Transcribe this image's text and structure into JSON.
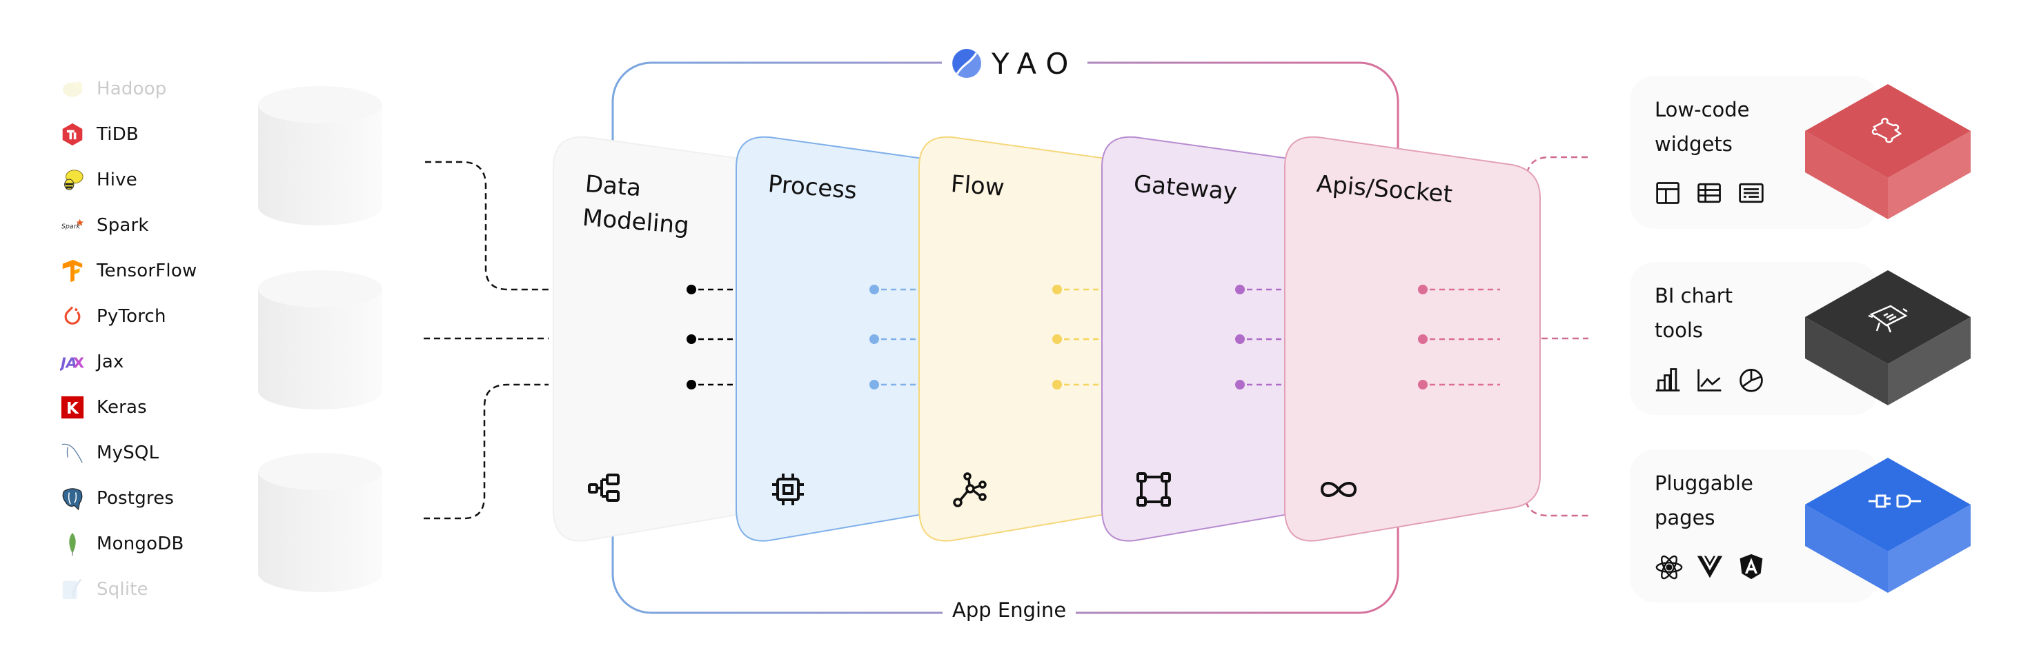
{
  "brand": {
    "name": "YAO",
    "logo_icon": "yao-yin-yang-logo"
  },
  "frame": {
    "bottom_label": "App Engine",
    "gradient_start": "#7aa7e0",
    "gradient_end": "#d9709a"
  },
  "sources": [
    {
      "label": "Hadoop",
      "icon": "hadoop-elephant-icon",
      "faded": true
    },
    {
      "label": "TiDB",
      "icon": "tidb-hexagon-icon",
      "faded": false
    },
    {
      "label": "Hive",
      "icon": "hive-bee-icon",
      "faded": false
    },
    {
      "label": "Spark",
      "icon": "spark-icon",
      "faded": false
    },
    {
      "label": "TensorFlow",
      "icon": "tensorflow-icon",
      "faded": false
    },
    {
      "label": "PyTorch",
      "icon": "pytorch-flame-icon",
      "faded": false
    },
    {
      "label": "Jax",
      "icon": "jax-icon",
      "faded": false
    },
    {
      "label": "Keras",
      "icon": "keras-k-icon",
      "faded": false
    },
    {
      "label": "MySQL",
      "icon": "mysql-dolphin-icon",
      "faded": false
    },
    {
      "label": "Postgres",
      "icon": "postgres-elephant-icon",
      "faded": false
    },
    {
      "label": "MongoDB",
      "icon": "mongodb-leaf-icon",
      "faded": false
    },
    {
      "label": "Sqlite",
      "icon": "sqlite-feather-icon",
      "faded": true
    }
  ],
  "pipeline": [
    {
      "title": "Data\nModeling",
      "icon": "hierarchy-icon",
      "fill": "#f8f8f8",
      "stroke": "#f0f0f0",
      "dot": "#000000"
    },
    {
      "title": "Process",
      "icon": "cpu-chip-icon",
      "fill": "#e4f0fb",
      "stroke": "#7fb0ea",
      "dot": "#7fb0ea"
    },
    {
      "title": "Flow",
      "icon": "network-nodes-icon",
      "fill": "#fdf6e2",
      "stroke": "#f5d77a",
      "dot": "#f5d35c"
    },
    {
      "title": "Gateway",
      "icon": "vector-square-icon",
      "fill": "#f0e3f3",
      "stroke": "#b78bd0",
      "dot": "#b06bc8"
    },
    {
      "title": "Apis/Socket",
      "icon": "infinity-icon",
      "fill": "#f8e2ea",
      "stroke": "#e2a0b7",
      "dot": "#dc6d95"
    }
  ],
  "outputs": [
    {
      "title": "Low-code\nwidgets",
      "cube_icon": "puzzle-piece-icon",
      "cube_top": "#d45258",
      "cube_left": "#da6266",
      "cube_right": "#e07478",
      "icons": [
        "layout-icon",
        "table-icon",
        "form-icon"
      ]
    },
    {
      "title": "BI chart\ntools",
      "cube_icon": "presentation-chart-icon",
      "cube_top": "#333333",
      "cube_left": "#474747",
      "cube_right": "#5a5a5a",
      "icons": [
        "bar-chart-icon",
        "line-chart-icon",
        "pie-chart-icon"
      ]
    },
    {
      "title": "Pluggable\npages",
      "cube_icon": "plug-icon",
      "cube_top": "#2f6fe3",
      "cube_left": "#4a7fe8",
      "cube_right": "#5b8cec",
      "icons": [
        "react-icon",
        "vue-icon",
        "angular-icon"
      ]
    }
  ]
}
